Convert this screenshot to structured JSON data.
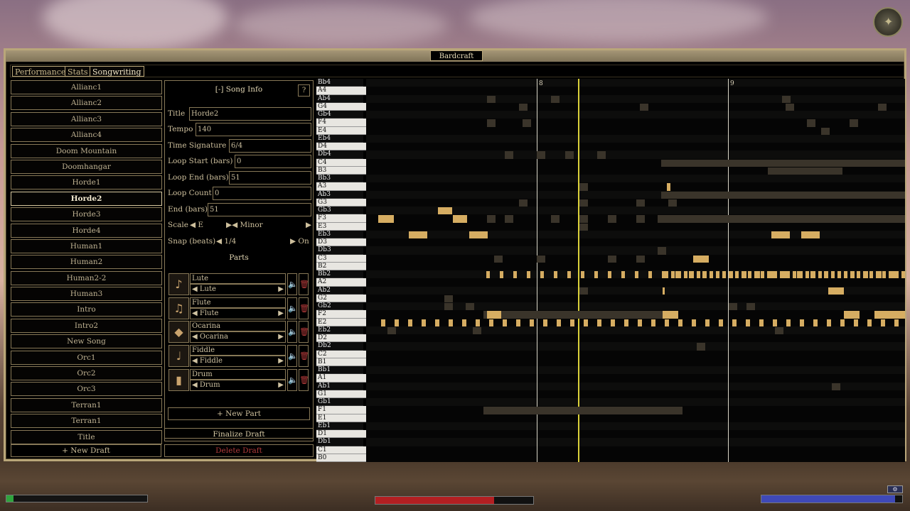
{
  "window": {
    "title": "Bardcraft"
  },
  "tabs": [
    {
      "label": "Performance",
      "active": false
    },
    {
      "label": "Stats",
      "active": false
    },
    {
      "label": "Songwriting",
      "active": true
    }
  ],
  "songs": [
    "Allianc1",
    "Allianc2",
    "Allianc3",
    "Allianc4",
    "Doom Mountain",
    "Doomhangar",
    "Horde1",
    "Horde2",
    "Horde3",
    "Horde4",
    "Human1",
    "Human2",
    "Human2-2",
    "Human3",
    "Intro",
    "Intro2",
    "New Song",
    "Orc1",
    "Orc2",
    "Orc3",
    "Terran1",
    "Terran1",
    "Title"
  ],
  "selected_song": "Horde2",
  "new_draft_label": "+ New Draft",
  "song_info": {
    "header": "[-] Song Info",
    "help": "?",
    "title_label": "Title",
    "title_value": "Horde2",
    "tempo_label": "Tempo",
    "tempo_value": "140",
    "timesig_label": "Time Signature",
    "timesig_value": "6/4",
    "loopstart_label": "Loop Start (bars)",
    "loopstart_value": "0",
    "loopend_label": "Loop End (bars)",
    "loopend_value": "51",
    "loopcount_label": "Loop Count",
    "loopcount_value": "0",
    "end_label": "End (bars)",
    "end_value": "51",
    "scale_label": "Scale",
    "scale_value": "◀ E",
    "scale_mode": "▶◀ Minor",
    "scale_next": "▶",
    "snap_label": "Snap (beats)",
    "snap_value": "◀ 1/4",
    "snap_toggle": "▶ On"
  },
  "parts_title": "Parts",
  "parts": [
    {
      "name": "Lute",
      "instrument": "Lute",
      "icon": "lute-icon"
    },
    {
      "name": "Flute",
      "instrument": "Flute",
      "icon": "flute-icon"
    },
    {
      "name": "Ocarina",
      "instrument": "Ocarina",
      "icon": "ocarina-icon"
    },
    {
      "name": "Fiddle",
      "instrument": "Fiddle",
      "icon": "fiddle-icon"
    },
    {
      "name": "Drum",
      "instrument": "Drum",
      "icon": "drum-icon"
    }
  ],
  "new_part_label": "+ New Part",
  "finalize_label": "Finalize Draft",
  "delete_label": "Delete Draft",
  "piano_keys": [
    "Bb4",
    "A4",
    "Ab4",
    "G4",
    "Gb4",
    "F4",
    "E4",
    "Eb4",
    "D4",
    "Db4",
    "C4",
    "B3",
    "Bb3",
    "A3",
    "Ab3",
    "G3",
    "Gb3",
    "F3",
    "E3",
    "Eb3",
    "D3",
    "Db3",
    "C3",
    "B2",
    "Bb2",
    "A2",
    "Ab2",
    "G2",
    "Gb2",
    "F2",
    "E2",
    "Eb2",
    "D2",
    "Db2",
    "C2",
    "B1",
    "Bb1",
    "A1",
    "Ab1",
    "G1",
    "Gb1",
    "F1",
    "E1",
    "Eb1",
    "D1",
    "Db1",
    "C1",
    "B0"
  ],
  "bar_markers": [
    "8",
    "9"
  ],
  "colors": {
    "accent": "#b9a679",
    "note": "#d6ad62",
    "ghost": "#3a342a",
    "playhead": "#d9d03a",
    "delete": "#b13b3b"
  },
  "hud": {
    "health_fill": 0.05,
    "magic_fill": 0.75,
    "fatigue_fill": 0.95
  }
}
